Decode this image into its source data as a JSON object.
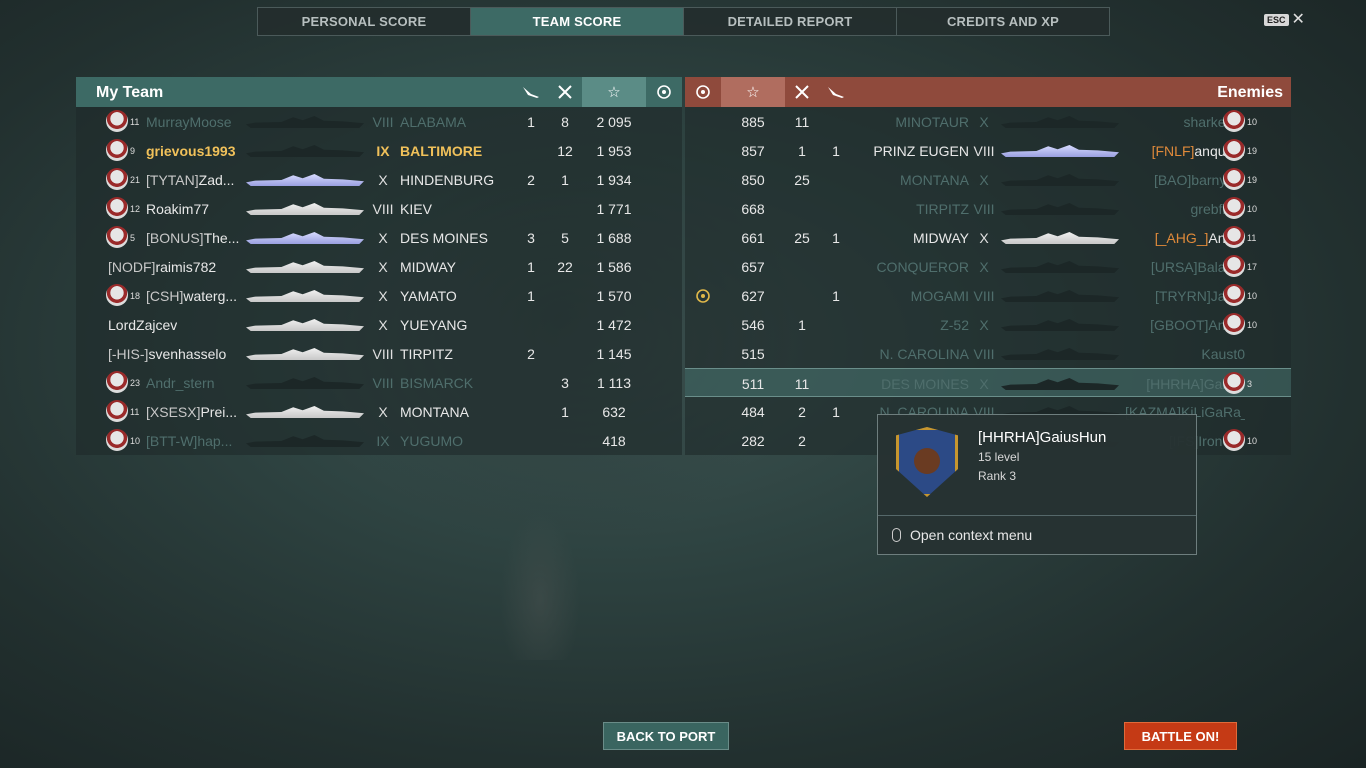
{
  "tabs": [
    {
      "label": "PERSONAL SCORE",
      "active": false
    },
    {
      "label": "TEAM SCORE",
      "active": true
    },
    {
      "label": "DETAILED REPORT",
      "active": false
    },
    {
      "label": "CREDITS AND XP",
      "active": false
    }
  ],
  "esc": {
    "key": "ESC",
    "close": "✕"
  },
  "my_team": {
    "title": "My Team",
    "columns": {
      "planes": "plane-icon",
      "kills": "kills-icon",
      "xp": "☆",
      "base": "base-icon"
    },
    "rows": [
      {
        "rank": "11",
        "clan": "",
        "name": "MurrayMoose",
        "tier": "VIII",
        "ship": "ALABAMA",
        "planes": "1",
        "kills": "8",
        "xp": "2 095",
        "dim": true,
        "self": false,
        "icon": true,
        "sil": "dark"
      },
      {
        "rank": "9",
        "clan": "",
        "name": "grievous1993",
        "tier": "IX",
        "ship": "BALTIMORE",
        "planes": "",
        "kills": "12",
        "xp": "1 953",
        "dim": false,
        "self": true,
        "icon": true,
        "sil": "dark"
      },
      {
        "rank": "21",
        "clan": "[TYTAN]",
        "name": "Zad...",
        "tier": "X",
        "ship": "HINDENBURG",
        "planes": "2",
        "kills": "1",
        "xp": "1 934",
        "dim": false,
        "self": false,
        "icon": true,
        "sil": "blue"
      },
      {
        "rank": "12",
        "clan": "",
        "name": "Roakim77",
        "tier": "VIII",
        "ship": "KIEV",
        "planes": "",
        "kills": "",
        "xp": "1 771",
        "dim": false,
        "self": false,
        "icon": true,
        "sil": "light"
      },
      {
        "rank": "5",
        "clan": "[BONUS]",
        "name": "The...",
        "tier": "X",
        "ship": "DES MOINES",
        "planes": "3",
        "kills": "5",
        "xp": "1 688",
        "dim": false,
        "self": false,
        "icon": true,
        "sil": "blue"
      },
      {
        "rank": "",
        "clan": "[NODF]",
        "name": "raimis782",
        "tier": "X",
        "ship": "MIDWAY",
        "planes": "1",
        "kills": "22",
        "xp": "1 586",
        "dim": false,
        "self": false,
        "icon": false,
        "sil": "light"
      },
      {
        "rank": "18",
        "clan": "[CSH]",
        "name": "waterg...",
        "tier": "X",
        "ship": "YAMATO",
        "planes": "1",
        "kills": "",
        "xp": "1 570",
        "dim": false,
        "self": false,
        "icon": true,
        "sil": "light"
      },
      {
        "rank": "",
        "clan": "",
        "name": "LordZajcev",
        "tier": "X",
        "ship": "YUEYANG",
        "planes": "",
        "kills": "",
        "xp": "1 472",
        "dim": false,
        "self": false,
        "icon": false,
        "sil": "light"
      },
      {
        "rank": "",
        "clan": "[-HIS-]",
        "name": "svenhasselo",
        "tier": "VIII",
        "ship": "TIRPITZ",
        "planes": "2",
        "kills": "",
        "xp": "1 145",
        "dim": false,
        "self": false,
        "icon": false,
        "sil": "light"
      },
      {
        "rank": "23",
        "clan": "",
        "name": "Andr_stern",
        "tier": "VIII",
        "ship": "BISMARCK",
        "planes": "",
        "kills": "3",
        "xp": "1 113",
        "dim": true,
        "self": false,
        "icon": true,
        "sil": "dark"
      },
      {
        "rank": "11",
        "clan": "[XSESX]",
        "name": "Prei...",
        "tier": "X",
        "ship": "MONTANA",
        "planes": "",
        "kills": "1",
        "xp": "632",
        "dim": false,
        "self": false,
        "icon": true,
        "sil": "light"
      },
      {
        "rank": "10",
        "clan": "[BTT-W]",
        "name": "hap...",
        "tier": "IX",
        "ship": "YUGUMO",
        "planes": "",
        "kills": "",
        "xp": "418",
        "dim": true,
        "self": false,
        "icon": true,
        "sil": "dark"
      }
    ]
  },
  "enemies": {
    "title": "Enemies",
    "rows": [
      {
        "base": "",
        "xp": "885",
        "kills": "11",
        "planes": "",
        "ship": "MINOTAUR",
        "tier": "X",
        "clan": "",
        "name": "sharkeu...",
        "rank": "10",
        "dim": true,
        "hl": false,
        "sil": "dark"
      },
      {
        "base": "",
        "xp": "857",
        "kills": "1",
        "planes": "1",
        "ship": "PRINZ EUGEN",
        "tier": "VIII",
        "clan": "[FNLF]",
        "name": "anque...",
        "rank": "19",
        "dim": false,
        "hl": false,
        "sil": "blue"
      },
      {
        "base": "",
        "xp": "850",
        "kills": "25",
        "planes": "",
        "ship": "MONTANA",
        "tier": "X",
        "clan": "[BAO]",
        "name": "barnys...",
        "rank": "19",
        "dim": true,
        "hl": false,
        "sil": "dark"
      },
      {
        "base": "",
        "xp": "668",
        "kills": "",
        "planes": "",
        "ship": "TIRPITZ",
        "tier": "VIII",
        "clan": "",
        "name": "grebflo...",
        "rank": "10",
        "dim": true,
        "hl": false,
        "sil": "dark"
      },
      {
        "base": "",
        "xp": "661",
        "kills": "25",
        "planes": "1",
        "ship": "MIDWAY",
        "tier": "X",
        "clan": "[_AHG_]",
        "name": "And...",
        "rank": "11",
        "dim": false,
        "hl": false,
        "sil": "light"
      },
      {
        "base": "",
        "xp": "657",
        "kills": "",
        "planes": "",
        "ship": "CONQUEROR",
        "tier": "X",
        "clan": "[URSA]",
        "name": "Balab...",
        "rank": "17",
        "dim": true,
        "hl": false,
        "sil": "dark"
      },
      {
        "base": "base",
        "xp": "627",
        "kills": "",
        "planes": "1",
        "ship": "MOGAMI",
        "tier": "VIII",
        "clan": "[TRYRN]",
        "name": "Jan...",
        "rank": "10",
        "dim": true,
        "hl": false,
        "sil": "dark"
      },
      {
        "base": "",
        "xp": "546",
        "kills": "1",
        "planes": "",
        "ship": "Z-52",
        "tier": "X",
        "clan": "[GBOOT]",
        "name": "And...",
        "rank": "10",
        "dim": true,
        "hl": false,
        "sil": "dark"
      },
      {
        "base": "",
        "xp": "515",
        "kills": "",
        "planes": "",
        "ship": "N. CAROLINA",
        "tier": "VIII",
        "clan": "",
        "name": "Kaust0",
        "rank": "",
        "dim": true,
        "hl": false,
        "sil": "dark"
      },
      {
        "base": "",
        "xp": "511",
        "kills": "11",
        "planes": "",
        "ship": "DES MOINES",
        "tier": "X",
        "clan": "[HHRHA]",
        "name": "Gaiu...",
        "rank": "3",
        "dim": true,
        "hl": true,
        "sil": "dark"
      },
      {
        "base": "",
        "xp": "484",
        "kills": "2",
        "planes": "1",
        "ship": "N. CAROLINA",
        "tier": "VIII",
        "clan": "[KAZMA]",
        "name": "KiLiGaRa_",
        "rank": "",
        "dim": true,
        "hl": false,
        "sil": "dark"
      },
      {
        "base": "",
        "xp": "282",
        "kills": "2",
        "planes": "",
        "ship": "",
        "tier": "",
        "clan": "[IFS]",
        "name": "Iron0j...",
        "rank": "10",
        "dim": true,
        "hl": false,
        "sil": "dark"
      }
    ]
  },
  "tooltip": {
    "player": "[HHRHA]GaiusHun",
    "level": "15 level",
    "rank": "Rank 3",
    "action": "Open context menu"
  },
  "buttons": {
    "back": "BACK TO PORT",
    "battle": "BATTLE ON!"
  },
  "colors": {
    "team_header": "#3d6a65",
    "enemy_header": "#8f4a3c",
    "self_highlight": "#f1c15a",
    "battle_button": "#c53a15"
  }
}
